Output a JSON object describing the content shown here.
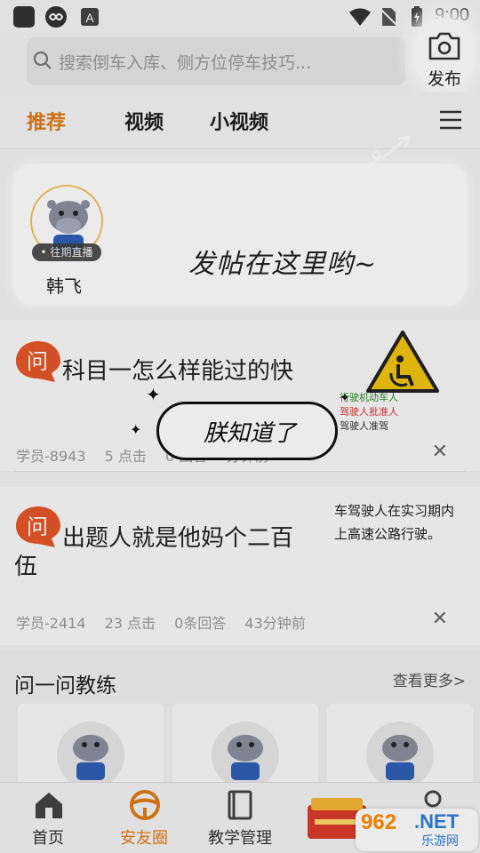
{
  "status_bar": {
    "time": "9:00",
    "icons": [
      "app-square-icon",
      "infinity-icon",
      "a-badge-icon",
      "wifi-icon",
      "no-sim-icon",
      "battery-charging-icon"
    ]
  },
  "search": {
    "placeholder": "搜索倒车入库、侧方位停车技巧..."
  },
  "publish": {
    "label": "发布",
    "icon": "camera-icon"
  },
  "tabs": [
    {
      "label": "推荐",
      "active": true
    },
    {
      "label": "视频",
      "active": false
    },
    {
      "label": "小视频",
      "active": false
    }
  ],
  "live_card": {
    "badge": "• 往期直播",
    "host_name": "韩飞",
    "hint": "发帖在这里哟~"
  },
  "posts": [
    {
      "title": "科目一怎么样能过的快",
      "meta": [
        "学员-8943",
        "5 点击",
        "0 回答",
        "分钟前"
      ]
    },
    {
      "title_line1": "出题人就是他妈个二百",
      "title_line2": "伍",
      "meta": [
        "学员-2414",
        "23 点击",
        "0条回答",
        "43分钟前"
      ]
    }
  ],
  "thumbnail": {
    "lines": [
      "行驶机动车人",
      "驾驶人批准人",
      "驾驶人准驾"
    ],
    "snippet_line1": "车驾驶人在实习期内",
    "snippet_line2": "上高速公路行驶。"
  },
  "tip_bubble": {
    "text": "朕知道了"
  },
  "coach_section": {
    "title": "问一问教练",
    "see_more": "查看更多>"
  },
  "bottom_nav": [
    {
      "label": "首页",
      "icon": "home-icon",
      "active": false
    },
    {
      "label": "安友圈",
      "icon": "steering-wheel-icon",
      "active": true
    },
    {
      "label": "教学管理",
      "icon": "book-icon",
      "active": false
    },
    {
      "label": "",
      "icon": "promo-icon",
      "active": false
    },
    {
      "label": "",
      "icon": "profile-icon",
      "active": false
    }
  ],
  "watermark": {
    "num": "962",
    "net": ".NET",
    "sub": "乐游网"
  },
  "colors": {
    "accent": "#e07a16",
    "icon_red": "#e5572a"
  }
}
